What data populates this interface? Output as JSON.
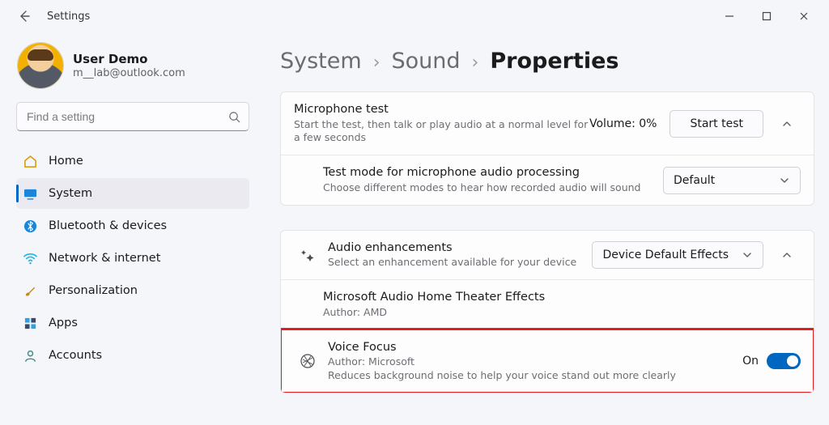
{
  "window": {
    "title": "Settings"
  },
  "user": {
    "name": "User Demo",
    "email": "m__lab@outlook.com"
  },
  "search": {
    "placeholder": "Find a setting"
  },
  "nav": {
    "home": "Home",
    "system": "System",
    "bluetooth": "Bluetooth & devices",
    "network": "Network & internet",
    "personalization": "Personalization",
    "apps": "Apps",
    "accounts": "Accounts"
  },
  "breadcrumb": {
    "a": "System",
    "b": "Sound",
    "c": "Properties"
  },
  "mic_test": {
    "title": "Microphone test",
    "sub": "Start the test, then talk or play audio at a normal level for a few seconds",
    "volume_label": "Volume: 0%",
    "button": "Start test",
    "mode_title": "Test mode for microphone audio processing",
    "mode_sub": "Choose different modes to hear how recorded audio will sound",
    "mode_value": "Default"
  },
  "enh": {
    "title": "Audio enhancements",
    "sub": "Select an enhancement available for your device",
    "value": "Device Default Effects",
    "item1_title": "Microsoft Audio Home Theater Effects",
    "item1_sub": "Author: AMD",
    "vf_title": "Voice Focus",
    "vf_author": "Author: Microsoft",
    "vf_sub": "Reduces background noise to help your voice stand out more clearly",
    "vf_state": "On"
  }
}
